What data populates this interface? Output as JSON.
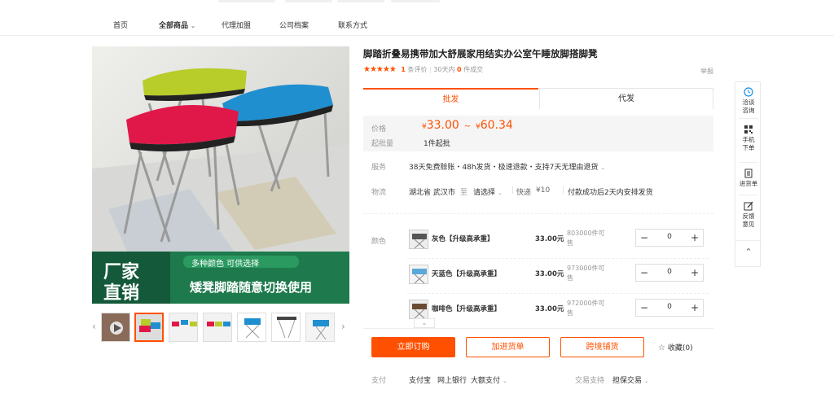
{
  "nav": {
    "items": [
      "首页",
      "全部商品",
      "代理加盟",
      "公司档案",
      "联系方式"
    ],
    "dropdown_icon": "chevron-down-icon"
  },
  "product": {
    "title": "脚踏折叠易携带加大舒展家用结实办公室午睡放脚搭脚凳",
    "stars": "★★★★★",
    "review_count": "1",
    "review_label": "条评价",
    "sales_prefix": "30天内",
    "sales_count": "0",
    "sales_suffix": "件成交",
    "report": "举报"
  },
  "tabs": [
    "批发",
    "代发"
  ],
  "price": {
    "label": "价格",
    "currency": "¥",
    "low": "33.00",
    "sep": "~",
    "high": "60.34",
    "moq_label": "起批量",
    "moq": "1件起批"
  },
  "service": {
    "label": "服务",
    "text": "38天免费赊账・48h发货・极速退款・支持7天无理由退货"
  },
  "logistics": {
    "label": "物流",
    "from": "湖北省 武汉市",
    "to": "至",
    "select": "请选择",
    "express": "快递",
    "fee": "¥10",
    "note": "付款成功后2天内安排发货"
  },
  "sku": {
    "label": "颜色",
    "items": [
      {
        "name": "灰色【升级高承重】",
        "price": "33.00元",
        "stock": "803000件可售",
        "qty": "0"
      },
      {
        "name": "天蓝色【升级高承重】",
        "price": "33.00元",
        "stock": "973000件可售",
        "qty": "0"
      },
      {
        "name": "咖啡色【升级高承重】",
        "price": "33.00元",
        "stock": "972000件可售",
        "qty": "0"
      }
    ]
  },
  "actions": {
    "buy": "立即订购",
    "add": "加进货单",
    "cross": "跨境铺货",
    "fav": "收藏(0)"
  },
  "payment": {
    "label": "支付",
    "methods": [
      "支付宝",
      "网上银行",
      "大额支付"
    ],
    "trade_label": "交易支持",
    "trade_value": "担保交易"
  },
  "sidebar": {
    "items": [
      "洽谈咨询",
      "手机下单",
      "进货单",
      "反馈意见"
    ]
  },
  "banner": {
    "l1": "厂家",
    "l2": "直销",
    "tag": "多种颜色 可供选择",
    "slogan": "矮凳脚踏随意切换使用"
  },
  "colors": {
    "accent": "#ff5000",
    "banner_green": "#1e7a4c"
  }
}
